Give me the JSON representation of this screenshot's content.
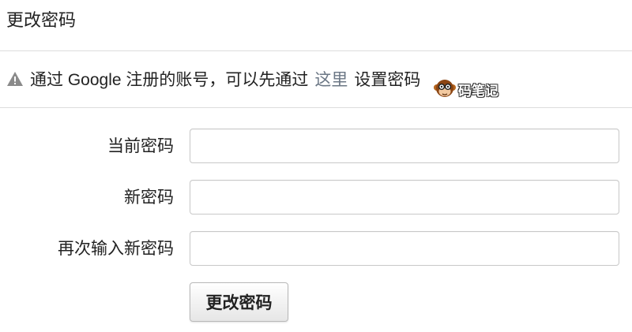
{
  "page_title": "更改密码",
  "notice": {
    "icon": "warning-icon",
    "text_before": "通过 Google 注册的账号，可以先通过",
    "link_text": "这里",
    "text_after": "设置密码",
    "link_color": "#6b7785"
  },
  "watermark": {
    "icon": "monkey-logo-icon",
    "text": "码笔记"
  },
  "form": {
    "current_password_label": "当前密码",
    "new_password_label": "新密码",
    "confirm_password_label": "再次输入新密码",
    "current_password_value": "",
    "new_password_value": "",
    "confirm_password_value": "",
    "submit_label": "更改密码"
  }
}
